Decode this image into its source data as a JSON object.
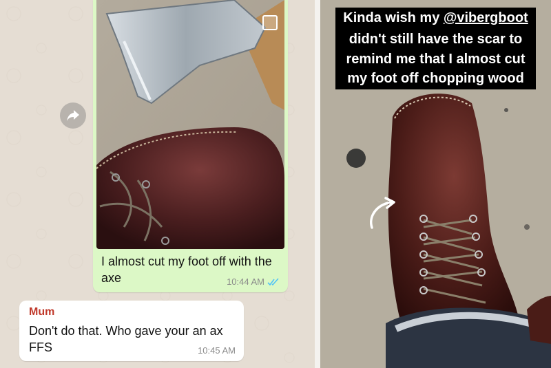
{
  "chat": {
    "outgoing": {
      "text": "I almost cut my foot off with the axe",
      "time": "10:44 AM"
    },
    "incoming": {
      "sender": "Mum",
      "text": "Don't do that. Who gave your an ax FFS",
      "time": "10:45 AM"
    }
  },
  "story": {
    "caption_line1": "Kinda wish my ",
    "mention": "@vibergboot",
    "caption_line2": "didn't still have the scar to",
    "caption_line3": "remind me that I almost cut",
    "caption_line4": "my foot off chopping wood"
  },
  "icons": {
    "forward": "forward-arrow-icon",
    "read_receipt": "double-check-icon",
    "select": "checkbox-icon"
  },
  "colors": {
    "outgoing_bubble": "#dcf8c6",
    "incoming_bubble": "#ffffff",
    "sender_name": "#c0392b",
    "read_tick": "#4fc3f7"
  }
}
